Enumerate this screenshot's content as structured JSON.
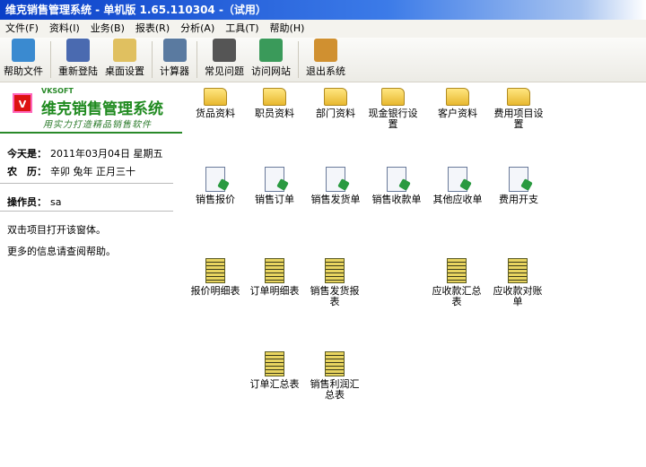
{
  "title": "维克销售管理系统 - 单机版 1.65.110304 -（试用）",
  "menu": [
    "文件(F)",
    "资料(I)",
    "业务(B)",
    "报表(R)",
    "分析(A)",
    "工具(T)",
    "帮助(H)"
  ],
  "toolbar": [
    "帮助文件",
    "重新登陆",
    "桌面设置",
    "计算器",
    "常见问题",
    "访问网站",
    "退出系统"
  ],
  "brand": {
    "logo": "V",
    "vksoft": "VKSOFT",
    "name": "维克销售管理系统",
    "slogan": "用实力打造精品销售软件"
  },
  "today_label": "今天是：",
  "today": "2011年03月04日  星期五",
  "lunar_label": "农　历：",
  "lunar": "辛卯 兔年 正月三十",
  "operator_label": "操作员：",
  "operator": "sa",
  "hint1": "双击项目打开该窗体。",
  "hint2": "更多的信息请查阅帮助。",
  "items": {
    "folders": [
      "货品资料",
      "职员资料",
      "部门资料",
      "现金银行设置",
      "客户资料",
      "费用项目设置"
    ],
    "docs": [
      "销售报价",
      "销售订单",
      "销售发货单",
      "销售收款单",
      "其他应收单",
      "费用开支"
    ],
    "reports": [
      "报价明细表",
      "订单明细表",
      "销售发货报表",
      "应收款汇总表",
      "应收款对账单",
      "订单汇总表",
      "销售利润汇总表"
    ]
  }
}
